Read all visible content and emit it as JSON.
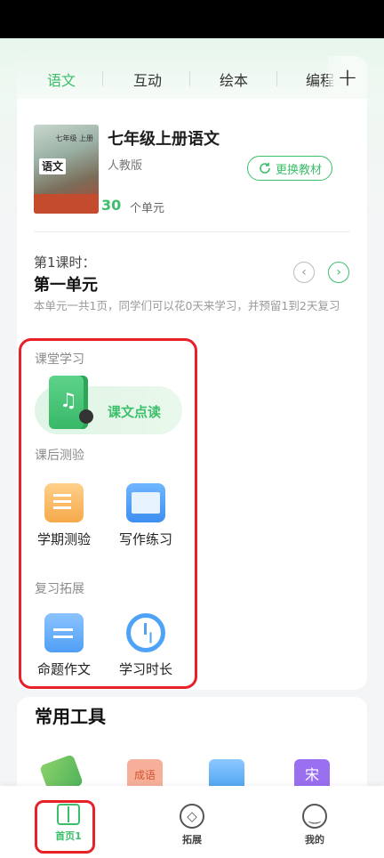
{
  "tabs": [
    "语文",
    "互动",
    "绘本",
    "编程"
  ],
  "book": {
    "cover_title": "七年级 上册",
    "cover_subject": "语文",
    "title": "七年级上册语文",
    "edition": "人教版",
    "change_label": "更换教材",
    "unit_count": "30",
    "unit_suffix": "个单元"
  },
  "lesson": {
    "label": "第1课时：",
    "name": "第一单元",
    "description": "本单元一共1页，同学们可以花0天来学习，并预留1到2天复习"
  },
  "sections": {
    "classroom": "课堂学习",
    "after_class": "课后测验",
    "review": "复习拓展"
  },
  "reading": {
    "label": "课文点读"
  },
  "after_class_items": [
    "学期测验",
    "写作练习"
  ],
  "review_items": [
    "命题作文",
    "学习时长"
  ],
  "tools": {
    "title": "常用工具",
    "idiom_badge": "成语",
    "song_badge": "宋"
  },
  "nav": [
    {
      "label": "首页1",
      "icon": "book-open-icon"
    },
    {
      "label": "拓展",
      "icon": "compass-icon"
    },
    {
      "label": "我的",
      "icon": "smile-icon"
    }
  ],
  "colors": {
    "accent": "#3cbf6a",
    "highlight_box": "#e8202a"
  }
}
